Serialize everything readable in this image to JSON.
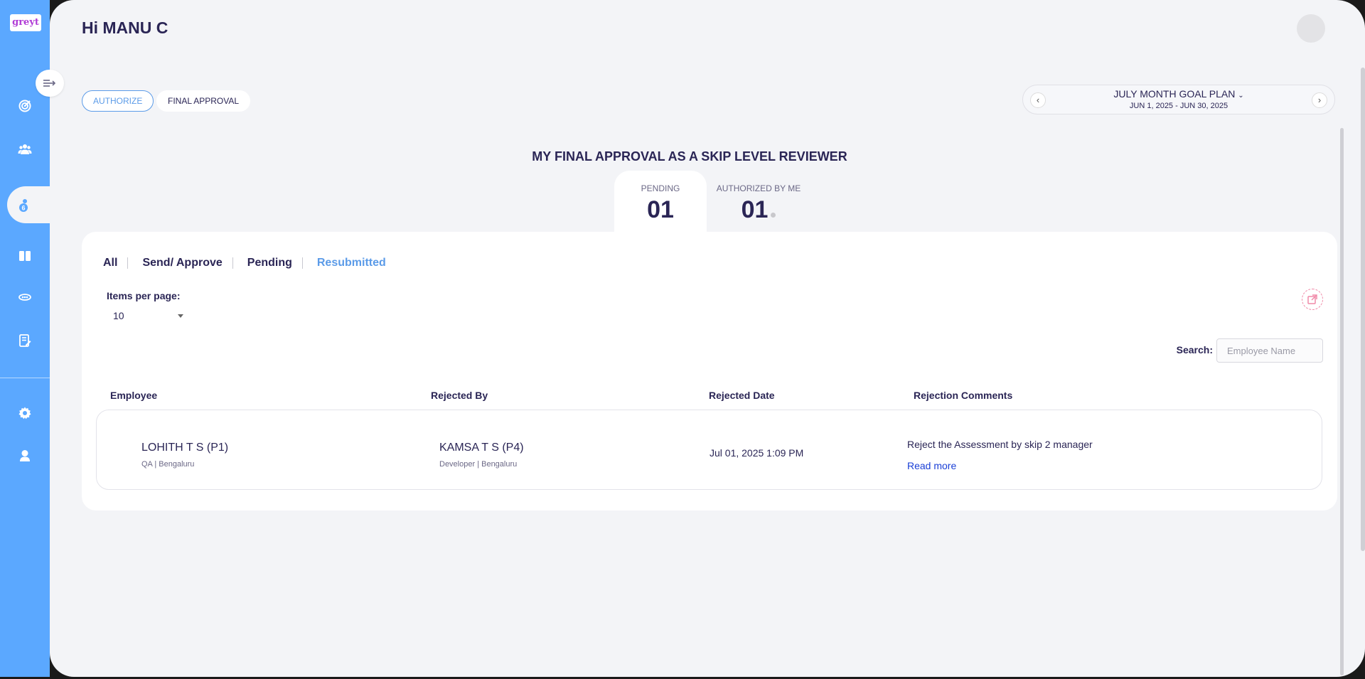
{
  "app": {
    "logo_text": "greyt"
  },
  "sidebar": {
    "items": [
      {
        "icon": "target-icon"
      },
      {
        "icon": "team-icon"
      },
      {
        "icon": "skip-review-icon",
        "badge": "6"
      },
      {
        "icon": "book-icon"
      },
      {
        "icon": "feedback-icon"
      },
      {
        "icon": "notes-icon"
      },
      {
        "icon": "gear-icon"
      },
      {
        "icon": "user-icon"
      }
    ]
  },
  "header": {
    "greeting": "Hi MANU C"
  },
  "tabs": {
    "authorize": "AUTHORIZE",
    "final_approval": "FINAL APPROVAL"
  },
  "goal_plan": {
    "title": "JULY MONTH GOAL PLAN",
    "range": "JUN 1, 2025 - JUN 30, 2025"
  },
  "section": {
    "title": "MY FINAL APPROVAL AS A SKIP LEVEL REVIEWER",
    "pending_label": "PENDING",
    "pending_value": "01",
    "authorized_label": "AUTHORIZED BY ME",
    "authorized_value": "01"
  },
  "filters": {
    "all": "All",
    "send_approve": "Send/ Approve",
    "pending": "Pending",
    "resubmitted": "Resubmitted"
  },
  "pagination": {
    "label": "Items per page:",
    "value": "10"
  },
  "search": {
    "label": "Search:",
    "placeholder": "Employee Name"
  },
  "table": {
    "headers": [
      "Employee",
      "Rejected By",
      "Rejected Date",
      "Rejection Comments"
    ],
    "rows": [
      {
        "employee": "LOHITH T S (P1)",
        "employee_sub": "QA | Bengaluru",
        "rejected_by": "KAMSA T S (P4)",
        "rejected_by_sub": "Developer | Bengaluru",
        "date": "Jul 01, 2025 1:09 PM",
        "comment": "Reject the Assessment by skip 2 manager",
        "read_more": "Read more"
      }
    ]
  },
  "colors": {
    "sidebar": "#5ba8ff",
    "accent": "#5b9be8",
    "text": "#2a2555",
    "link": "#1a3fd6"
  }
}
